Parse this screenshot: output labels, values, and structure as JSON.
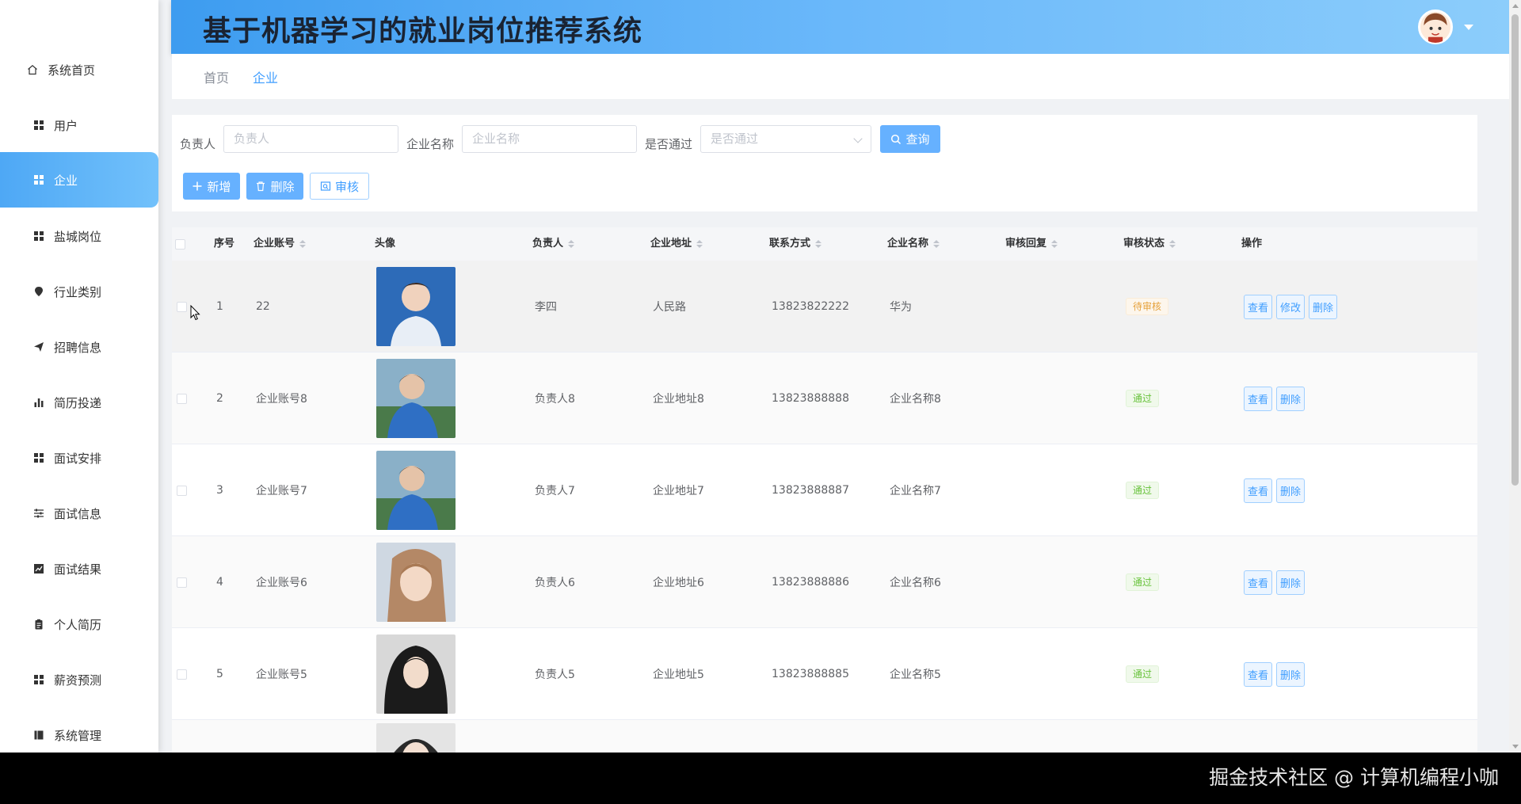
{
  "header": {
    "title": "基于机器学习的就业岗位推荐系统"
  },
  "sidebar": {
    "items": [
      {
        "label": "系统首页",
        "icon": "home-icon"
      },
      {
        "label": "用户",
        "icon": "grid-icon"
      },
      {
        "label": "企业",
        "icon": "grid-icon",
        "active": true
      },
      {
        "label": "盐城岗位",
        "icon": "grid-icon"
      },
      {
        "label": "行业类别",
        "icon": "pin-icon"
      },
      {
        "label": "招聘信息",
        "icon": "send-icon"
      },
      {
        "label": "简历投递",
        "icon": "bar-chart-icon"
      },
      {
        "label": "面试安排",
        "icon": "grid-icon"
      },
      {
        "label": "面试信息",
        "icon": "sliders-icon"
      },
      {
        "label": "面试结果",
        "icon": "line-chart-icon"
      },
      {
        "label": "个人简历",
        "icon": "clipboard-icon"
      },
      {
        "label": "薪资预测",
        "icon": "grid-icon"
      },
      {
        "label": "系统管理",
        "icon": "book-icon"
      }
    ]
  },
  "breadcrumb": {
    "home": "首页",
    "current": "企业"
  },
  "search": {
    "owner_label": "负责人",
    "owner_placeholder": "负责人",
    "company_label": "企业名称",
    "company_placeholder": "企业名称",
    "passed_label": "是否通过",
    "passed_placeholder": "是否通过",
    "query_button": "查询"
  },
  "actions": {
    "add": "新增",
    "delete": "删除",
    "review": "审核"
  },
  "table": {
    "headers": {
      "index": "序号",
      "account": "企业账号",
      "avatar": "头像",
      "owner": "负责人",
      "address": "企业地址",
      "phone": "联系方式",
      "name": "企业名称",
      "reply": "审核回复",
      "status": "审核状态",
      "ops": "操作"
    },
    "rows": [
      {
        "index": "1",
        "account": "22",
        "owner": "李四",
        "address": "人民路",
        "phone": "13823822222",
        "name": "华为",
        "reply": "",
        "status": "待审核",
        "status_type": "warn",
        "ops": [
          "查看",
          "修改",
          "删除"
        ]
      },
      {
        "index": "2",
        "account": "企业账号8",
        "owner": "负责人8",
        "address": "企业地址8",
        "phone": "13823888888",
        "name": "企业名称8",
        "reply": "",
        "status": "通过",
        "status_type": "ok",
        "ops": [
          "查看",
          "删除"
        ]
      },
      {
        "index": "3",
        "account": "企业账号7",
        "owner": "负责人7",
        "address": "企业地址7",
        "phone": "13823888887",
        "name": "企业名称7",
        "reply": "",
        "status": "通过",
        "status_type": "ok",
        "ops": [
          "查看",
          "删除"
        ]
      },
      {
        "index": "4",
        "account": "企业账号6",
        "owner": "负责人6",
        "address": "企业地址6",
        "phone": "13823888886",
        "name": "企业名称6",
        "reply": "",
        "status": "通过",
        "status_type": "ok",
        "ops": [
          "查看",
          "删除"
        ]
      },
      {
        "index": "5",
        "account": "企业账号5",
        "owner": "负责人5",
        "address": "企业地址5",
        "phone": "13823888885",
        "name": "企业名称5",
        "reply": "",
        "status": "通过",
        "status_type": "ok",
        "ops": [
          "查看",
          "删除"
        ]
      }
    ]
  },
  "watermark": "掘金技术社区 @ 计算机编程小咖",
  "colors": {
    "accent": "#409eff",
    "header_start": "#3d9cf0",
    "header_end": "#8ccdfb",
    "warn": "#e6a23c",
    "ok": "#67c23a"
  }
}
